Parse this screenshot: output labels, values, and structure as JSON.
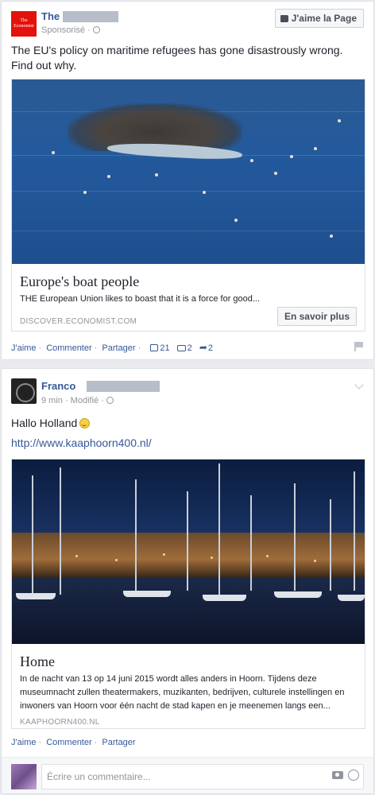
{
  "post1": {
    "logo_text": "The Economist",
    "author_visible": "The",
    "sponsored": "Sponsorisé ·",
    "like_page_button": "J'aime la Page",
    "text": "The EU's policy on maritime refugees has gone disastrously wrong. Find out why.",
    "image_icon": "migrant-boat-photo",
    "attachment": {
      "title": "Europe's boat people",
      "description": "THE European Union likes to boast that it is a force for good...",
      "domain": "DISCOVER.ECONOMIST.COM",
      "cta": "En savoir plus"
    },
    "actions": {
      "like": "J'aime",
      "comment": "Commenter",
      "share": "Partager",
      "like_count": "21",
      "comment_count": "2",
      "share_count": "2"
    }
  },
  "post2": {
    "author_visible": "Franco",
    "meta": "9 min · Modifié ·",
    "text": "Hallo Holland",
    "url": "http://www.kaaphoorn400.nl/",
    "image_icon": "harbor-night-photo",
    "attachment": {
      "title": "Home",
      "description": "In de nacht van 13 op 14 juni 2015 wordt alles anders in Hoorn. Tijdens deze museumnacht zullen theatermakers, muzikanten, bedrijven, culturele instellingen en inwoners van Hoorn voor één nacht de stad kapen en je meenemen langs een...",
      "domain": "KAAPHOORN400.NL"
    },
    "actions": {
      "like": "J'aime",
      "comment": "Commenter",
      "share": "Partager"
    }
  },
  "comment_box": {
    "placeholder": "Écrire un commentaire..."
  },
  "colors": {
    "link": "#365899",
    "economist_red": "#e3120b",
    "background": "#e9ebee"
  }
}
